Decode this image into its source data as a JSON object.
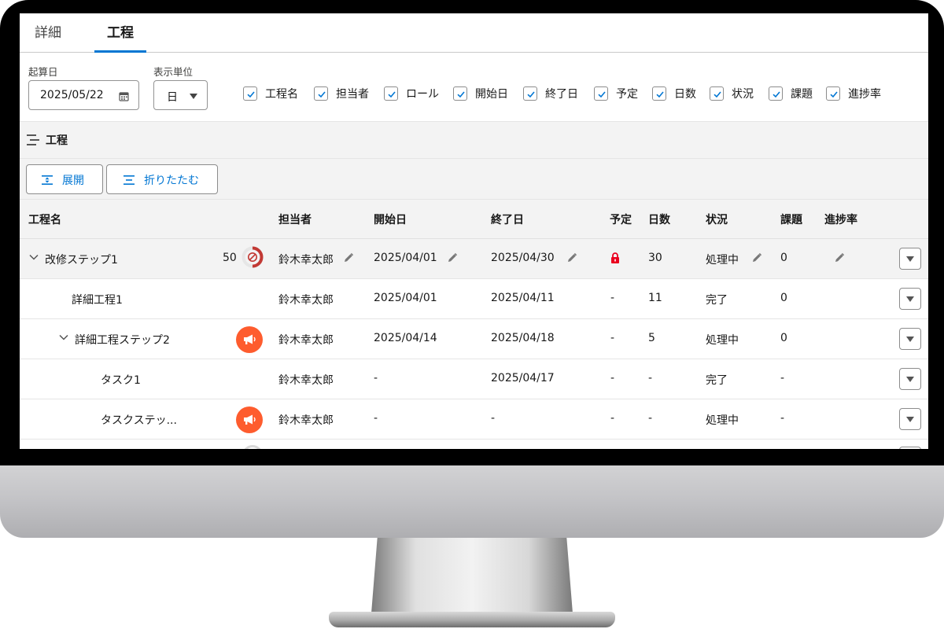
{
  "tabs": [
    {
      "label": "詳細",
      "active": false
    },
    {
      "label": "工程",
      "active": true
    }
  ],
  "toolbar": {
    "start_date_label": "起算日",
    "start_date_value": "2025/05/22",
    "unit_label": "表示単位",
    "unit_value": "日",
    "column_toggles": [
      {
        "label": "工程名",
        "checked": true
      },
      {
        "label": "担当者",
        "checked": true
      },
      {
        "label": "ロール",
        "checked": true
      },
      {
        "label": "開始日",
        "checked": true
      },
      {
        "label": "終了日",
        "checked": true
      },
      {
        "label": "予定",
        "checked": true
      },
      {
        "label": "日数",
        "checked": true
      },
      {
        "label": "状況",
        "checked": true
      },
      {
        "label": "課題",
        "checked": true
      },
      {
        "label": "進捗率",
        "checked": true
      }
    ]
  },
  "section": {
    "title": "工程"
  },
  "buttons": {
    "expand": "展開",
    "collapse": "折りたたむ"
  },
  "table": {
    "headers": {
      "name": "工程名",
      "assignee": "担当者",
      "start": "開始日",
      "end": "終了日",
      "plan": "予定",
      "days": "日数",
      "status": "状況",
      "issues": "課題",
      "progress": "進捗率"
    },
    "rows": [
      {
        "name": "改修ステップ1",
        "score": "50",
        "assignee": "鈴木幸太郎",
        "start": "2025/04/01",
        "end": "2025/04/30",
        "plan": "",
        "days": "30",
        "status": "処理中",
        "issues": "0",
        "progress": ""
      },
      {
        "name": "詳細工程1",
        "assignee": "鈴木幸太郎",
        "start": "2025/04/01",
        "end": "2025/04/11",
        "plan": "-",
        "days": "11",
        "status": "完了",
        "issues": "0"
      },
      {
        "name": "詳細工程ステップ2",
        "assignee": "鈴木幸太郎",
        "start": "2025/04/14",
        "end": "2025/04/18",
        "plan": "-",
        "days": "5",
        "status": "処理中",
        "issues": "0"
      },
      {
        "name": "タスク1",
        "assignee": "鈴木幸太郎",
        "start": "-",
        "end": "2025/04/17",
        "plan": "-",
        "days": "-",
        "status": "完了",
        "issues": "-"
      },
      {
        "name": "タスクステッ...",
        "assignee": "鈴木幸太郎",
        "start": "-",
        "end": "-",
        "plan": "-",
        "days": "-",
        "status": "処理中",
        "issues": "-"
      }
    ]
  },
  "colors": {
    "accent": "#0176d3",
    "badge_orange": "#fe5c2e",
    "lock_red": "#ea001e"
  },
  "icons": [
    "calendar-icon",
    "caret-down-icon",
    "checkbox-check-icon",
    "list-icon",
    "expand-icon",
    "collapse-icon",
    "chevron-down-icon",
    "pencil-icon",
    "progress-ring-icon",
    "megaphone-icon",
    "lock-icon"
  ]
}
